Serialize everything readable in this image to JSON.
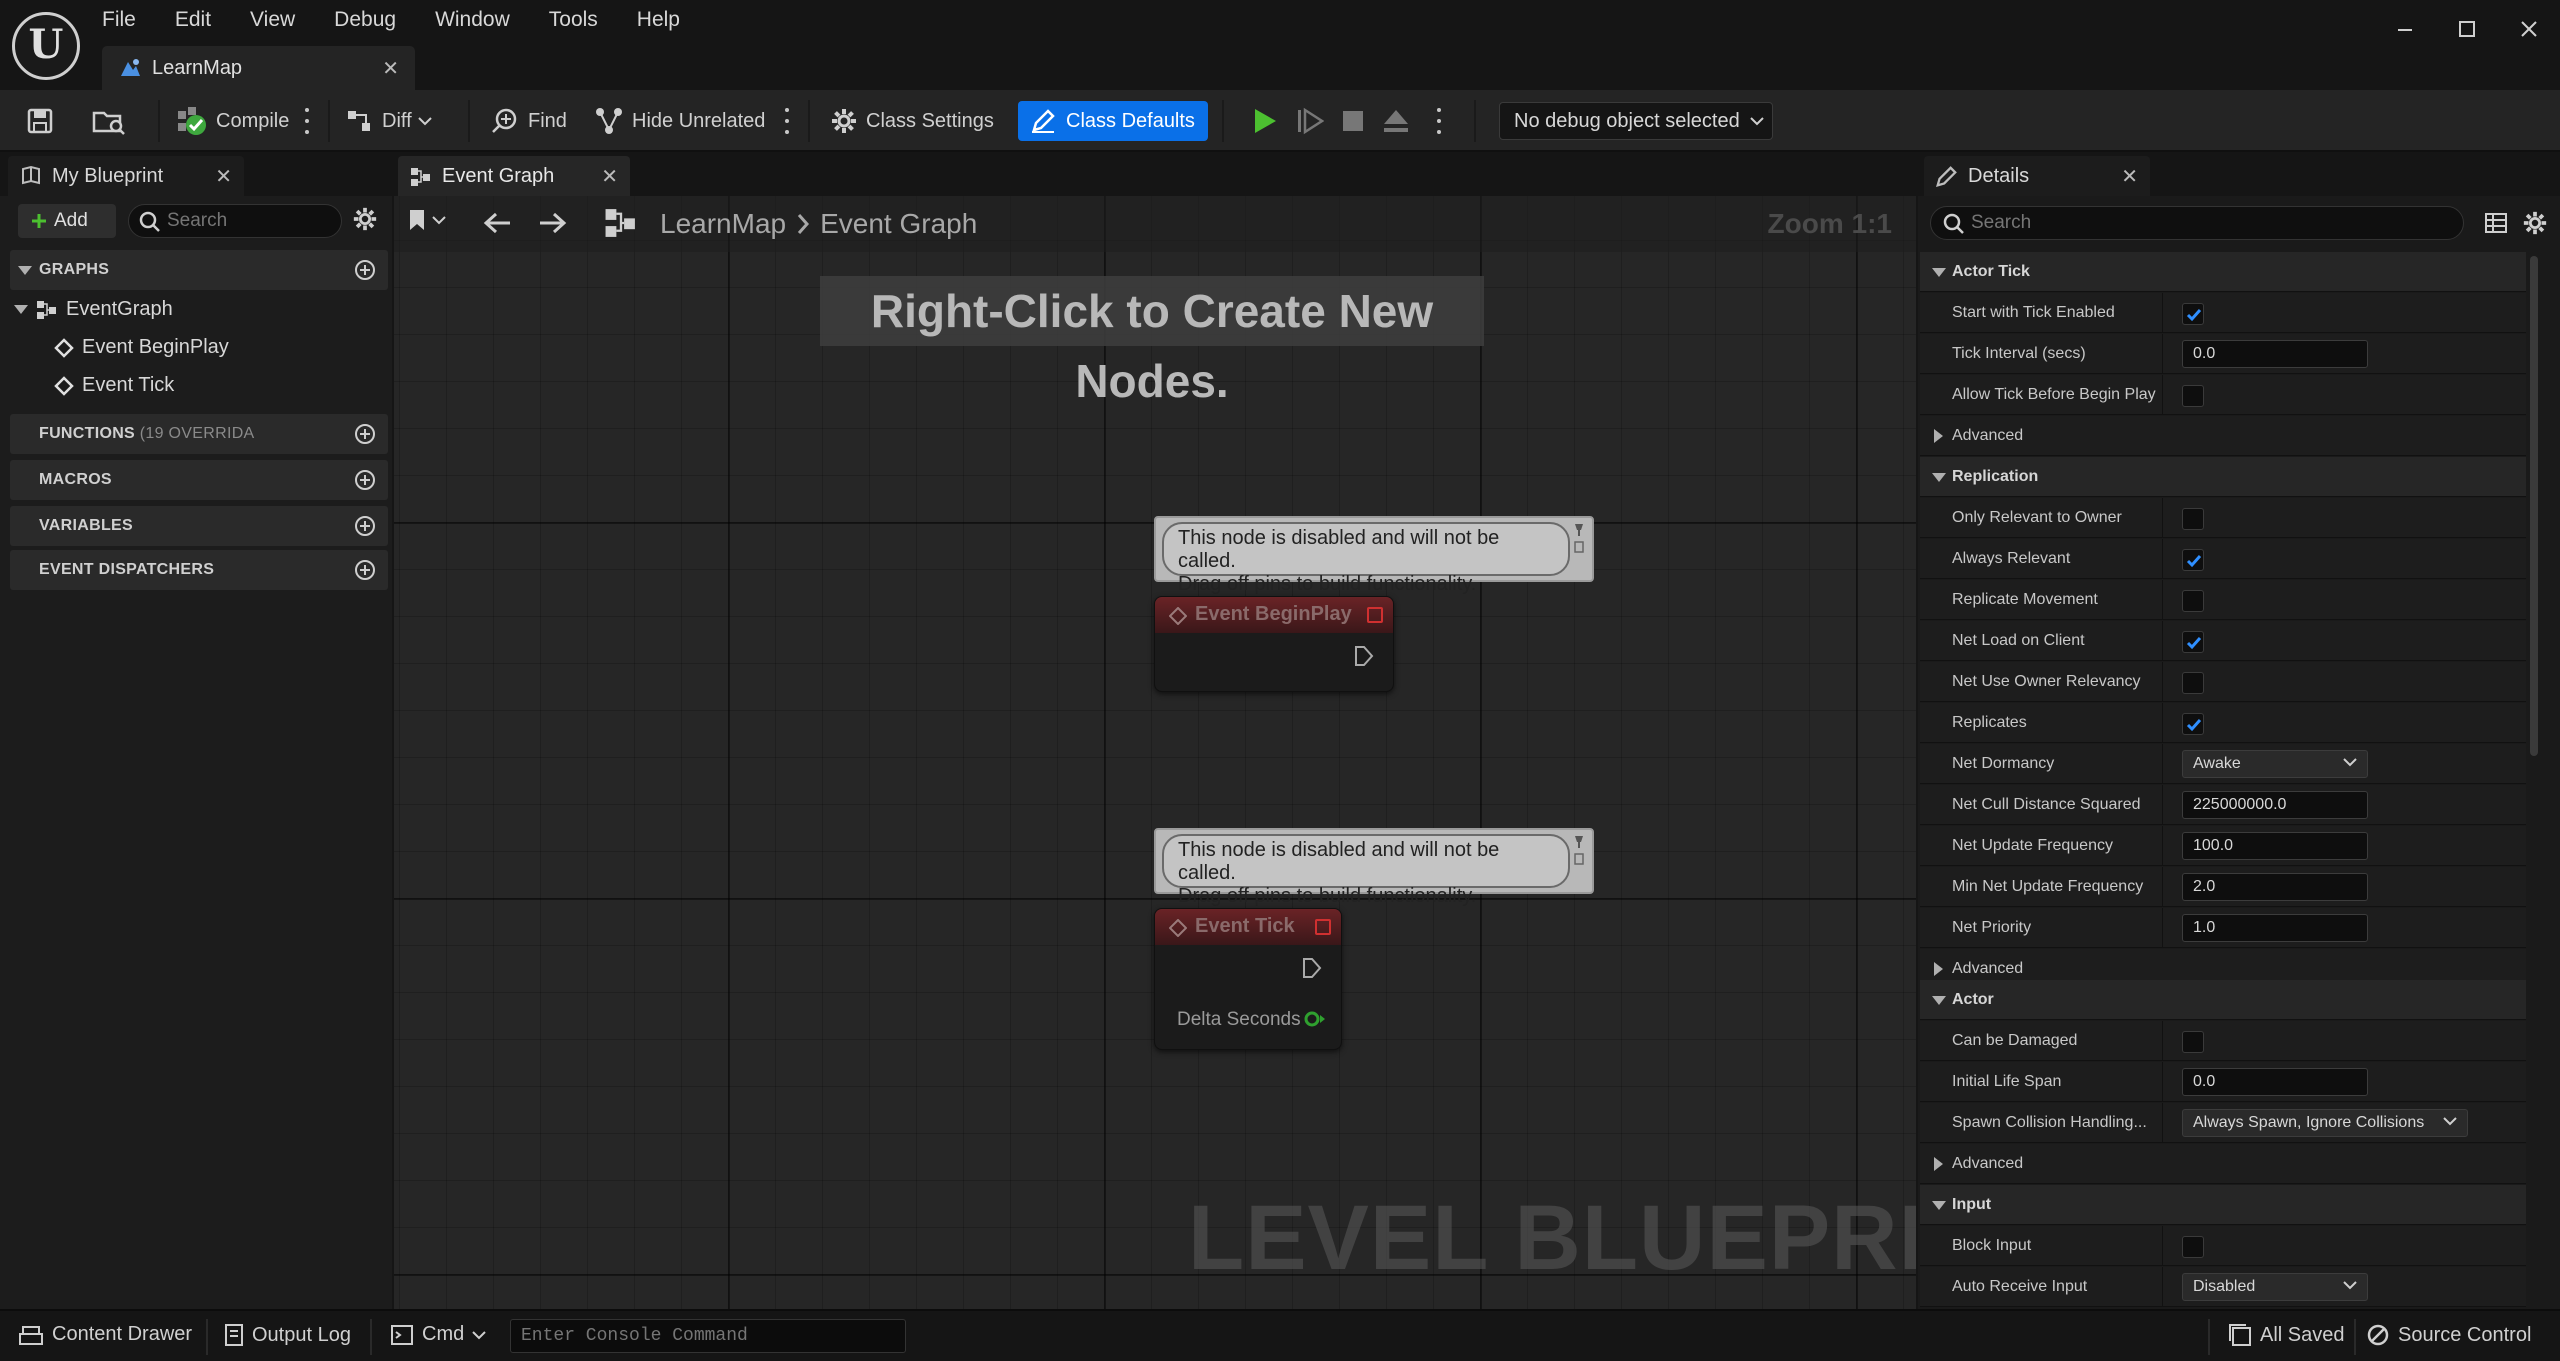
{
  "app": {
    "logo_letter": "U",
    "menus": [
      "File",
      "Edit",
      "View",
      "Debug",
      "Window",
      "Tools",
      "Help"
    ],
    "document_tab": "LearnMap"
  },
  "toolbar": {
    "compile": "Compile",
    "diff": "Diff",
    "find": "Find",
    "hide_unrelated": "Hide Unrelated",
    "class_settings": "Class Settings",
    "class_defaults": "Class Defaults",
    "debug_object": "No debug object selected"
  },
  "my_blueprint": {
    "tab": "My Blueprint",
    "add": "Add",
    "search_placeholder": "Search",
    "sections": {
      "graphs": "GRAPHS",
      "functions": "FUNCTIONS",
      "functions_sub": "(19 OVERRIDA",
      "macros": "MACROS",
      "variables": "VARIABLES",
      "dispatchers": "EVENT DISPATCHERS"
    },
    "graph_tree": {
      "root": "EventGraph",
      "children": [
        "Event BeginPlay",
        "Event Tick"
      ]
    }
  },
  "graph": {
    "tab": "Event Graph",
    "breadcrumb": [
      "LearnMap",
      "Event Graph"
    ],
    "zoom": "Zoom 1:1",
    "hint": "Right-Click to Create New Nodes.",
    "watermark": "LEVEL BLUEPRINT",
    "nodes": [
      {
        "title": "Event BeginPlay",
        "comment": [
          "This node is disabled and will not be called.",
          "Drag off pins to build functionality."
        ]
      },
      {
        "title": "Event Tick",
        "comment": [
          "This node is disabled and will not be called.",
          "Drag off pins to build functionality."
        ],
        "pin": "Delta Seconds"
      }
    ]
  },
  "details": {
    "tab": "Details",
    "search_placeholder": "Search",
    "rows": [
      {
        "kind": "cat",
        "label": "Actor Tick"
      },
      {
        "kind": "check",
        "label": "Start with Tick Enabled",
        "checked": true
      },
      {
        "kind": "text",
        "label": "Tick Interval (secs)",
        "value": "0.0"
      },
      {
        "kind": "check",
        "label": "Allow Tick Before Begin Play",
        "checked": false
      },
      {
        "kind": "adv",
        "label": "Advanced"
      },
      {
        "kind": "cat",
        "label": "Replication"
      },
      {
        "kind": "check",
        "label": "Only Relevant to Owner",
        "checked": false
      },
      {
        "kind": "check",
        "label": "Always Relevant",
        "checked": true
      },
      {
        "kind": "check",
        "label": "Replicate Movement",
        "checked": false
      },
      {
        "kind": "check",
        "label": "Net Load on Client",
        "checked": true
      },
      {
        "kind": "check",
        "label": "Net Use Owner Relevancy",
        "checked": false
      },
      {
        "kind": "check",
        "label": "Replicates",
        "checked": true
      },
      {
        "kind": "dd",
        "label": "Net Dormancy",
        "value": "Awake"
      },
      {
        "kind": "text",
        "label": "Net Cull Distance Squared",
        "value": "225000000.0"
      },
      {
        "kind": "text",
        "label": "Net Update Frequency",
        "value": "100.0"
      },
      {
        "kind": "text",
        "label": "Min Net Update Frequency",
        "value": "2.0"
      },
      {
        "kind": "text",
        "label": "Net Priority",
        "value": "1.0"
      },
      {
        "kind": "adv",
        "label": "Advanced"
      },
      {
        "kind": "cat",
        "label": "Actor"
      },
      {
        "kind": "check",
        "label": "Can be Damaged",
        "checked": false
      },
      {
        "kind": "text",
        "label": "Initial Life Span",
        "value": "0.0"
      },
      {
        "kind": "ddw",
        "label": "Spawn Collision Handling...",
        "value": "Always Spawn, Ignore Collisions"
      },
      {
        "kind": "adv",
        "label": "Advanced"
      },
      {
        "kind": "cat",
        "label": "Input"
      },
      {
        "kind": "check",
        "label": "Block Input",
        "checked": false
      },
      {
        "kind": "dd",
        "label": "Auto Receive Input",
        "value": "Disabled"
      }
    ]
  },
  "statusbar": {
    "content_drawer": "Content Drawer",
    "output_log": "Output Log",
    "cmd": "Cmd",
    "console_placeholder": "Enter Console Command",
    "all_saved": "All Saved",
    "source_control": "Source Control"
  },
  "colors": {
    "accent": "#0a70e8",
    "node_header": "#6a2326",
    "play_green": "#4cc030"
  }
}
